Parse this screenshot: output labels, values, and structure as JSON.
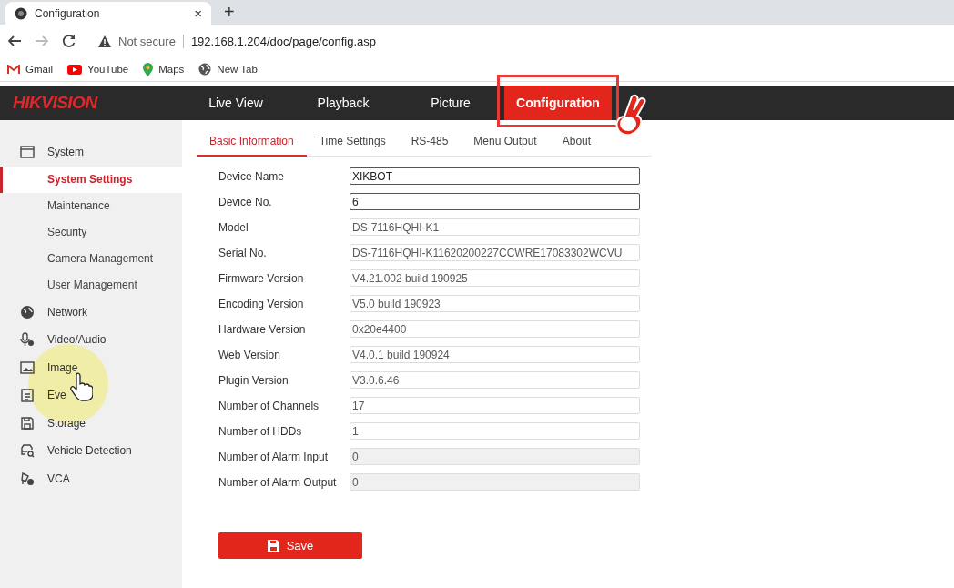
{
  "browser": {
    "tab_title": "Configuration",
    "new_tab": "+",
    "close": "×",
    "security": "Not secure",
    "url": "192.168.1.204/doc/page/config.asp",
    "bookmarks": [
      {
        "label": "Gmail",
        "kind": "mail"
      },
      {
        "label": "YouTube",
        "kind": "video"
      },
      {
        "label": "Maps",
        "kind": "pin"
      },
      {
        "label": "New Tab",
        "kind": "globe"
      }
    ]
  },
  "app": {
    "logo": "HIKVISION",
    "nav": [
      {
        "label": "Live View",
        "selected": false
      },
      {
        "label": "Playback",
        "selected": false
      },
      {
        "label": "Picture",
        "selected": false
      },
      {
        "label": "Configuration",
        "selected": true,
        "annotated": true
      }
    ]
  },
  "sidebar": {
    "items": [
      {
        "label": "System",
        "children": [
          {
            "label": "System Settings",
            "selected": true
          },
          {
            "label": "Maintenance",
            "selected": false
          },
          {
            "label": "Security",
            "selected": false
          },
          {
            "label": "Camera Management",
            "selected": false
          },
          {
            "label": "User Management",
            "selected": false
          }
        ]
      },
      {
        "label": "Network"
      },
      {
        "label": "Video/Audio"
      },
      {
        "label": "Image"
      },
      {
        "label": "Eve",
        "pointer": true
      },
      {
        "label": "Storage"
      },
      {
        "label": "Vehicle Detection"
      },
      {
        "label": "VCA"
      }
    ]
  },
  "tabs": [
    {
      "label": "Basic Information",
      "selected": true
    },
    {
      "label": "Time Settings",
      "selected": false
    },
    {
      "label": "RS-485",
      "selected": false
    },
    {
      "label": "Menu Output",
      "selected": false
    },
    {
      "label": "About",
      "selected": false
    }
  ],
  "fields": [
    {
      "label": "Device Name",
      "value": "XIKBOT",
      "kind": "editable"
    },
    {
      "label": "Device No.",
      "value": "6",
      "kind": "editable"
    },
    {
      "label": "Model",
      "value": "DS-7116HQHI-K1",
      "kind": "readonly"
    },
    {
      "label": "Serial No.",
      "value": "DS-7116HQHI-K11620200227CCWRE17083302WCVU",
      "kind": "readonly"
    },
    {
      "label": "Firmware Version",
      "value": "V4.21.002 build 190925",
      "kind": "readonly"
    },
    {
      "label": "Encoding Version",
      "value": "V5.0 build 190923",
      "kind": "readonly"
    },
    {
      "label": "Hardware Version",
      "value": "0x20e4400",
      "kind": "readonly"
    },
    {
      "label": "Web Version",
      "value": "V4.0.1 build 190924",
      "kind": "readonly"
    },
    {
      "label": "Plugin Version",
      "value": "V3.0.6.46",
      "kind": "readonly"
    },
    {
      "label": "Number of Channels",
      "value": "17",
      "kind": "readonly"
    },
    {
      "label": "Number of HDDs",
      "value": "1",
      "kind": "readonly"
    },
    {
      "label": "Number of Alarm Input",
      "value": "0",
      "kind": "disabled"
    },
    {
      "label": "Number of Alarm Output",
      "value": "0",
      "kind": "disabled"
    }
  ],
  "save_button": "Save"
}
